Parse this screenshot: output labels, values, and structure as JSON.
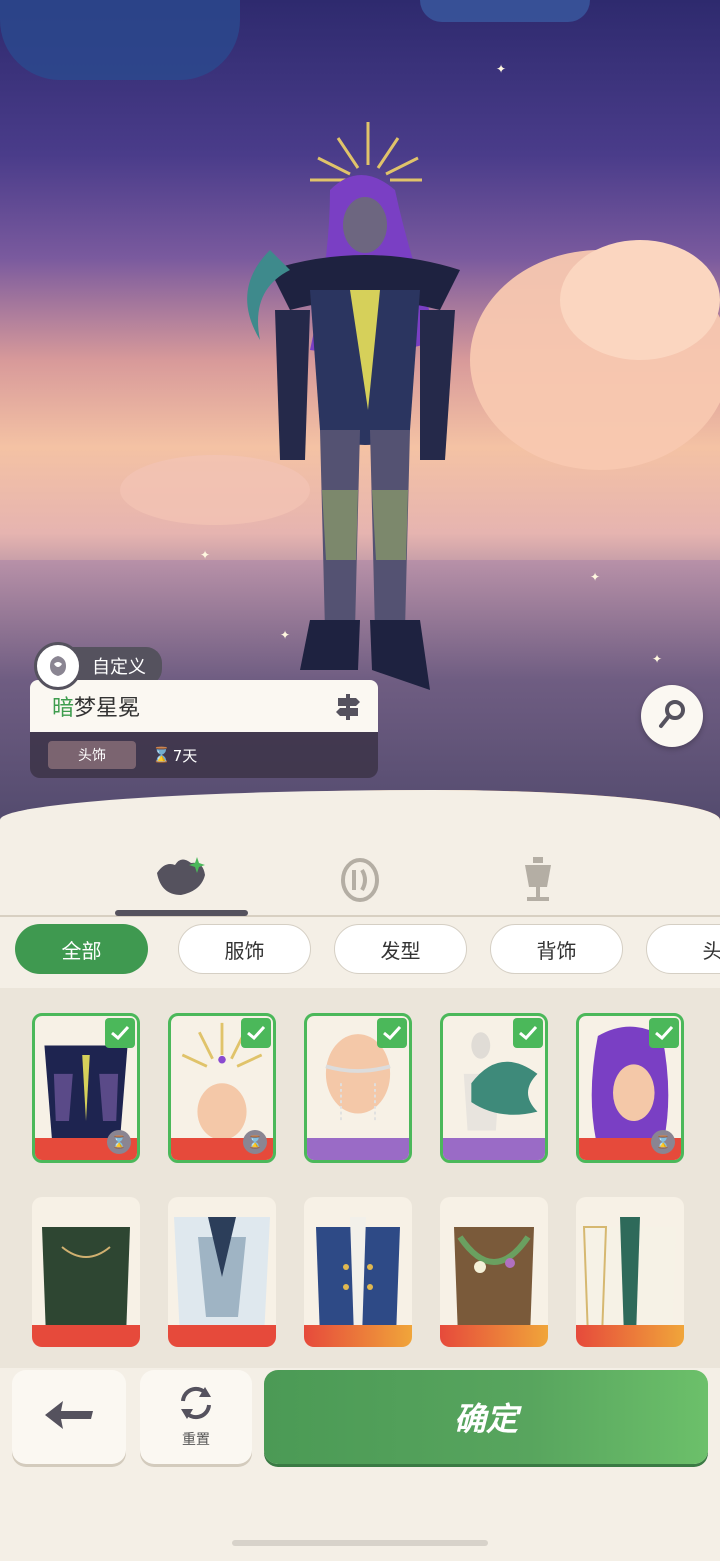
{
  "item_info": {
    "custom_label": "自定义",
    "name_first_char": "暗",
    "name_rest": "梦星冕",
    "category": "头饰",
    "duration": "7天"
  },
  "main_tabs": [
    {
      "icon": "outfit-icon",
      "active": true
    },
    {
      "icon": "dye-icon",
      "active": false
    },
    {
      "icon": "mannequin-icon",
      "active": false
    }
  ],
  "filters": [
    "全部",
    "服饰",
    "发型",
    "背饰",
    "头"
  ],
  "active_filter": "全部",
  "grid": {
    "row1": [
      {
        "name": "dark-armor-outfit",
        "selected": true,
        "limited": true
      },
      {
        "name": "golden-crown-headwear",
        "selected": true,
        "limited": true
      },
      {
        "name": "pearl-chain-face-accessory",
        "selected": true,
        "limited": false
      },
      {
        "name": "coral-tentacle-back-accessory",
        "selected": true,
        "limited": false
      },
      {
        "name": "purple-long-hairstyle",
        "selected": true,
        "limited": true
      }
    ],
    "row2": [
      {
        "name": "dark-green-leaf-outfit"
      },
      {
        "name": "crystal-ice-outfit"
      },
      {
        "name": "navy-gold-coat-outfit"
      },
      {
        "name": "flower-garland-outfit"
      },
      {
        "name": "white-gold-robe-outfit"
      }
    ]
  },
  "buttons": {
    "reset_label": "重置",
    "confirm_label": "确定"
  },
  "colors": {
    "accent_green": "#3f9950",
    "select_green": "#4bb85a",
    "panel_dark": "#55525e"
  }
}
